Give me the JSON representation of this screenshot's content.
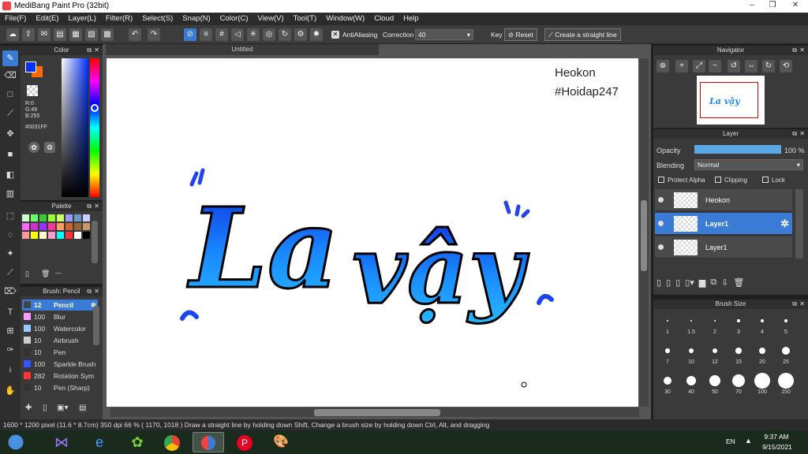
{
  "window": {
    "title": "MediBang Paint Pro (32bit)"
  },
  "menu": [
    "File(F)",
    "Edit(E)",
    "Layer(L)",
    "Filter(R)",
    "Select(S)",
    "Snap(N)",
    "Color(C)",
    "View(V)",
    "Tool(T)",
    "Window(W)",
    "Cloud",
    "Help"
  ],
  "toolbar": {
    "antialias_label": "AntiAliasing",
    "correction_label": "Correction",
    "correction_value": "40",
    "key_label": "Key",
    "reset_label": "Reset",
    "straight_line_label": "Create a straight line"
  },
  "color_panel": {
    "title": "Color",
    "r": "R:0",
    "g": "G:49",
    "b": "B:255",
    "hex": "#0031FF",
    "primary": "#0031FF",
    "secondary": "#FF6A00"
  },
  "palette_panel": {
    "title": "Palette",
    "footer": "---",
    "swatches": [
      "#ccffcc",
      "#66ff66",
      "#33cc33",
      "#99ff33",
      "#ccff66",
      "#9999ff",
      "#6699cc",
      "#ccccff",
      "#ff66ff",
      "#cc33cc",
      "#9933ff",
      "#ff3399",
      "#ff9966",
      "#cc6633",
      "#996633",
      "#cc9966",
      "#ff9999",
      "#ffff00",
      "#ffffcc",
      "#ff99cc",
      "#00ffff",
      "#ff3333",
      "#ffffff",
      "#000000"
    ]
  },
  "brush_panel": {
    "title": "Brush: Pencil",
    "items": [
      {
        "size": "12",
        "name": "Pencil",
        "color": "#444444",
        "active": true
      },
      {
        "size": "100",
        "name": "Blur",
        "color": "#ff99ff"
      },
      {
        "size": "100",
        "name": "Watercolor",
        "color": "#99ccff"
      },
      {
        "size": "10",
        "name": "Airbrush",
        "color": "#cccccc"
      },
      {
        "size": "10",
        "name": "Pen",
        "color": "#333333"
      },
      {
        "size": "100",
        "name": "Sparkle Brush",
        "color": "#3355ff"
      },
      {
        "size": "282",
        "name": "Rotation Sym",
        "color": "#ff3333"
      },
      {
        "size": "10",
        "name": "Pen (Sharp)",
        "color": "#333333"
      }
    ]
  },
  "canvas": {
    "tab": "Untitled",
    "credit_line1": "Heokon",
    "credit_line2": "#Hoidap247",
    "art_text": "La vậy"
  },
  "navigator": {
    "title": "Navigator",
    "preview_text": "La vậy"
  },
  "layer_panel": {
    "title": "Layer",
    "opacity_label": "Opacity",
    "opacity_value": "100 %",
    "opacity": 1.0,
    "blending_label": "Blending",
    "blending_value": "Normal",
    "protect_alpha": "Protect Alpha",
    "clipping": "Clipping",
    "lock": "Lock",
    "layers": [
      {
        "name": "Heokon",
        "active": false
      },
      {
        "name": "Layer1",
        "active": true
      },
      {
        "name": "Layer1",
        "active": false
      }
    ]
  },
  "brush_size_panel": {
    "title": "Brush Size",
    "sizes": [
      "1",
      "1.5",
      "2",
      "3",
      "4",
      "5",
      "7",
      "10",
      "12",
      "15",
      "20",
      "25",
      "30",
      "40",
      "50",
      "70",
      "100",
      "150"
    ]
  },
  "status": {
    "text": "1600 * 1200 pixel    (11.6 * 8.7cm)   350 dpi   66 %    ( 1170, 1018 )    Draw a straight line by holding down Shift, Change a brush size by holding down Ctrl, Alt, and dragging"
  },
  "taskbar": {
    "lang": "EN",
    "time": "9:37 AM",
    "date": "9/15/2021"
  }
}
